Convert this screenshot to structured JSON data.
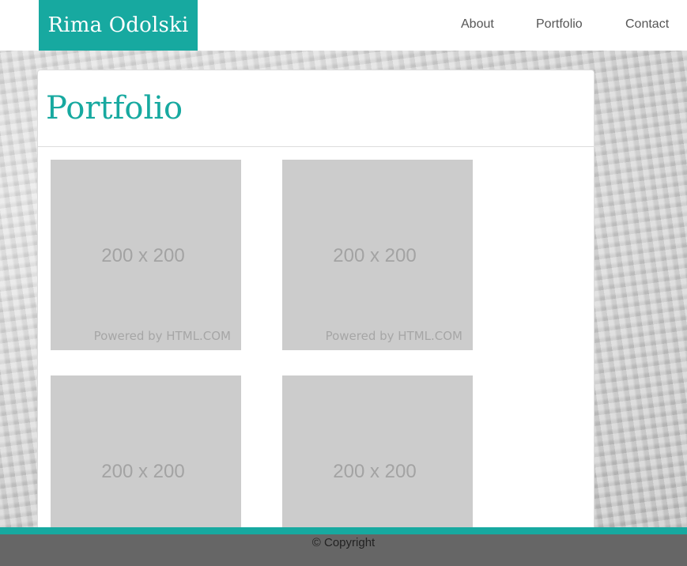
{
  "site": {
    "brand": "Rima Odolski",
    "nav": [
      {
        "label": "About"
      },
      {
        "label": "Portfolio"
      },
      {
        "label": "Contact"
      }
    ]
  },
  "main": {
    "title": "Portfolio",
    "tiles": [
      {
        "size_label": "200 x 200",
        "credit": "Powered by HTML.COM"
      },
      {
        "size_label": "200 x 200",
        "credit": "Powered by HTML.COM"
      },
      {
        "size_label": "200 x 200",
        "credit": ""
      },
      {
        "size_label": "200 x 200",
        "credit": ""
      }
    ]
  },
  "footer": {
    "copyright": "© Copyright"
  },
  "colors": {
    "accent": "#17a9a0",
    "placeholder": "#cccccc",
    "footer": "#666666"
  }
}
